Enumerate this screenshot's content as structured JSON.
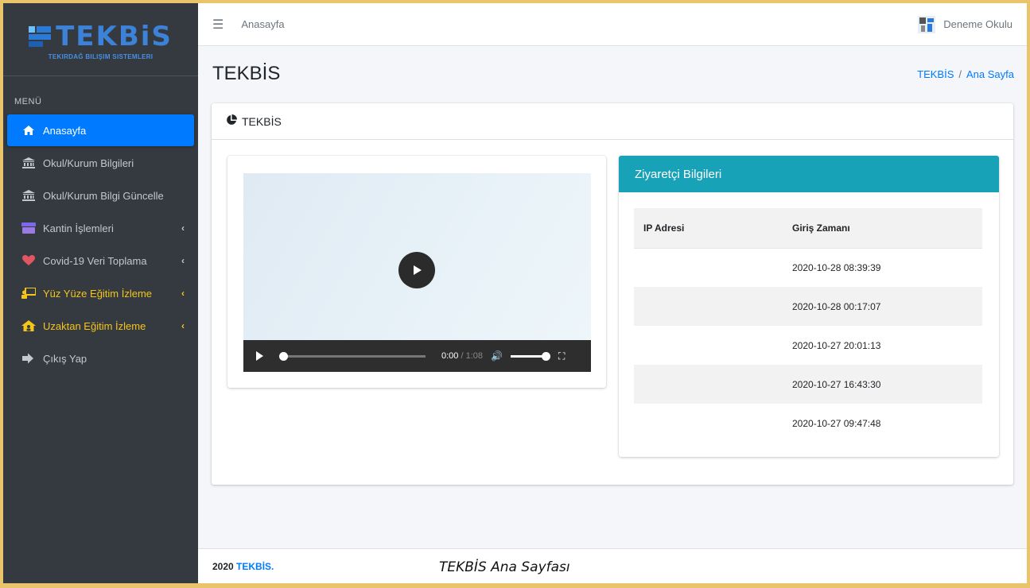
{
  "brand": {
    "word": "TEKBiS",
    "subtitle": "TEKIRDAĞ BILIŞIM SISTEMLERI"
  },
  "sidebar": {
    "header": "MENÜ",
    "items": [
      {
        "label": "Anasayfa",
        "icon": "home-icon",
        "active": true
      },
      {
        "label": "Okul/Kurum Bilgileri",
        "icon": "institution-icon"
      },
      {
        "label": "Okul/Kurum Bilgi Güncelle",
        "icon": "institution-icon"
      },
      {
        "label": "Kantin İşlemleri",
        "icon": "store-icon",
        "expandable": true
      },
      {
        "label": "Covid-19 Veri Toplama",
        "icon": "heartbeat-icon",
        "expandable": true
      },
      {
        "label": "Yüz Yüze Eğitim İzleme",
        "icon": "chalkboard-teacher-icon",
        "expandable": true
      },
      {
        "label": "Uzaktan Eğitim İzleme",
        "icon": "house-user-icon",
        "expandable": true
      },
      {
        "label": "Çıkış Yap",
        "icon": "sign-out-icon"
      }
    ]
  },
  "topbar": {
    "link": "Anasayfa",
    "school": "Deneme Okulu"
  },
  "header": {
    "title": "TEKBİS",
    "breadcrumb": [
      "TEKBİS",
      "Ana Sayfa"
    ]
  },
  "card": {
    "title": "TEKBİS"
  },
  "video": {
    "current_time": "0:00",
    "duration": "1:08",
    "progress": 0,
    "volume": 1.0
  },
  "visitors": {
    "title": "Ziyaretçi Bilgileri",
    "columns": [
      "IP Adresi",
      "Giriş Zamanı"
    ],
    "rows": [
      [
        "",
        "2020-10-28 08:39:39"
      ],
      [
        "",
        "2020-10-28 00:17:07"
      ],
      [
        "",
        "2020-10-27 20:01:13"
      ],
      [
        "",
        "2020-10-27 16:43:30"
      ],
      [
        "",
        "2020-10-27 09:47:48"
      ]
    ]
  },
  "footer": {
    "year": "2020",
    "brand": "TEKBİS."
  },
  "caption": "TEKBİS Ana Sayfası",
  "colors": {
    "sidebar_bg": "#343a40",
    "active": "#007bff",
    "highlight": "#f5c518",
    "visitor_header": "#17a2b8",
    "frame": "#e9c46a"
  }
}
